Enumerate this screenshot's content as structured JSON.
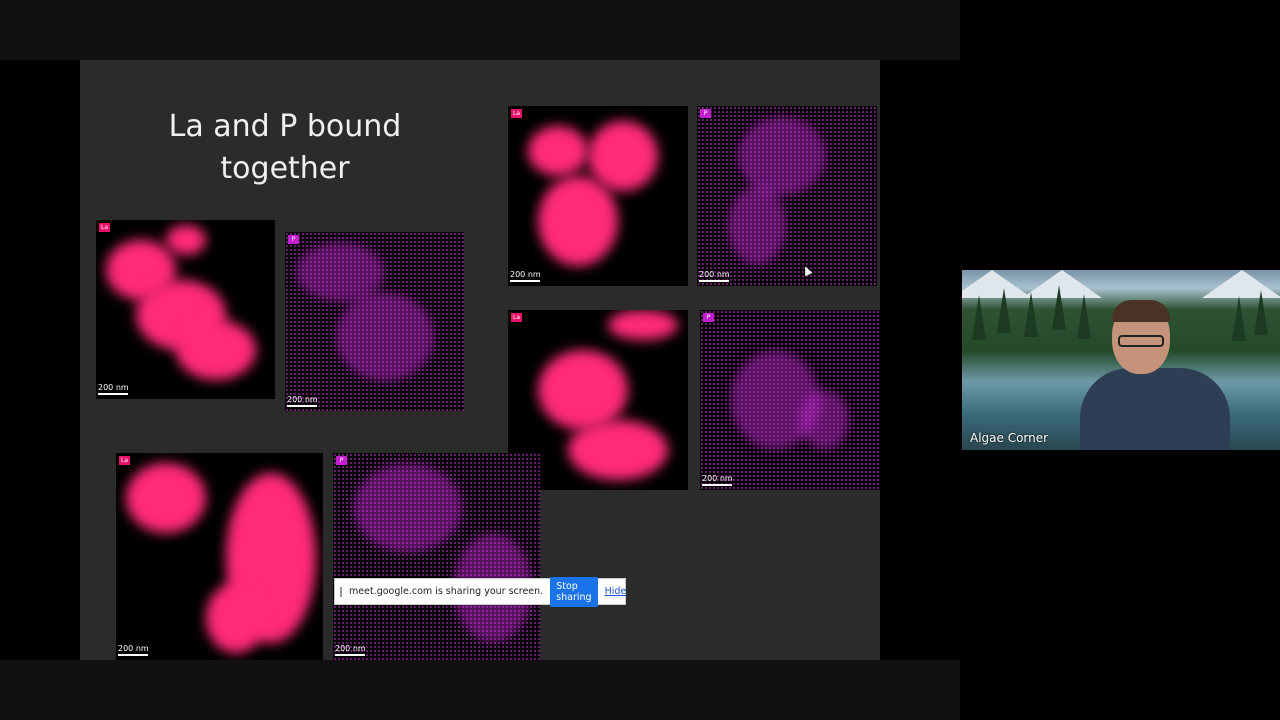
{
  "slide": {
    "title_line1": "La and P bound",
    "title_line2": "together",
    "maps": [
      {
        "id": "mid-left-la",
        "element": "La",
        "scale": "200 nm"
      },
      {
        "id": "mid-left-p",
        "element": "P",
        "scale": "200 nm"
      },
      {
        "id": "top-right-la",
        "element": "La",
        "scale": "200 nm"
      },
      {
        "id": "top-right-p",
        "element": "P",
        "scale": "200 nm"
      },
      {
        "id": "mid-right-la",
        "element": "La",
        "scale": ""
      },
      {
        "id": "mid-right-p",
        "element": "P",
        "scale": "200 nm"
      },
      {
        "id": "bottom-la",
        "element": "La",
        "scale": "200 nm"
      },
      {
        "id": "bottom-p",
        "element": "P",
        "scale": "200 nm"
      }
    ]
  },
  "share_banner": {
    "message": "meet.google.com is sharing your screen.",
    "stop_label": "Stop sharing",
    "hide_label": "Hide"
  },
  "video": {
    "participant_name": "Algae Corner"
  },
  "colors": {
    "lanthanum": "#ff2a78",
    "phosphorus": "#c42cd4",
    "stop_button": "#1a73e8"
  }
}
